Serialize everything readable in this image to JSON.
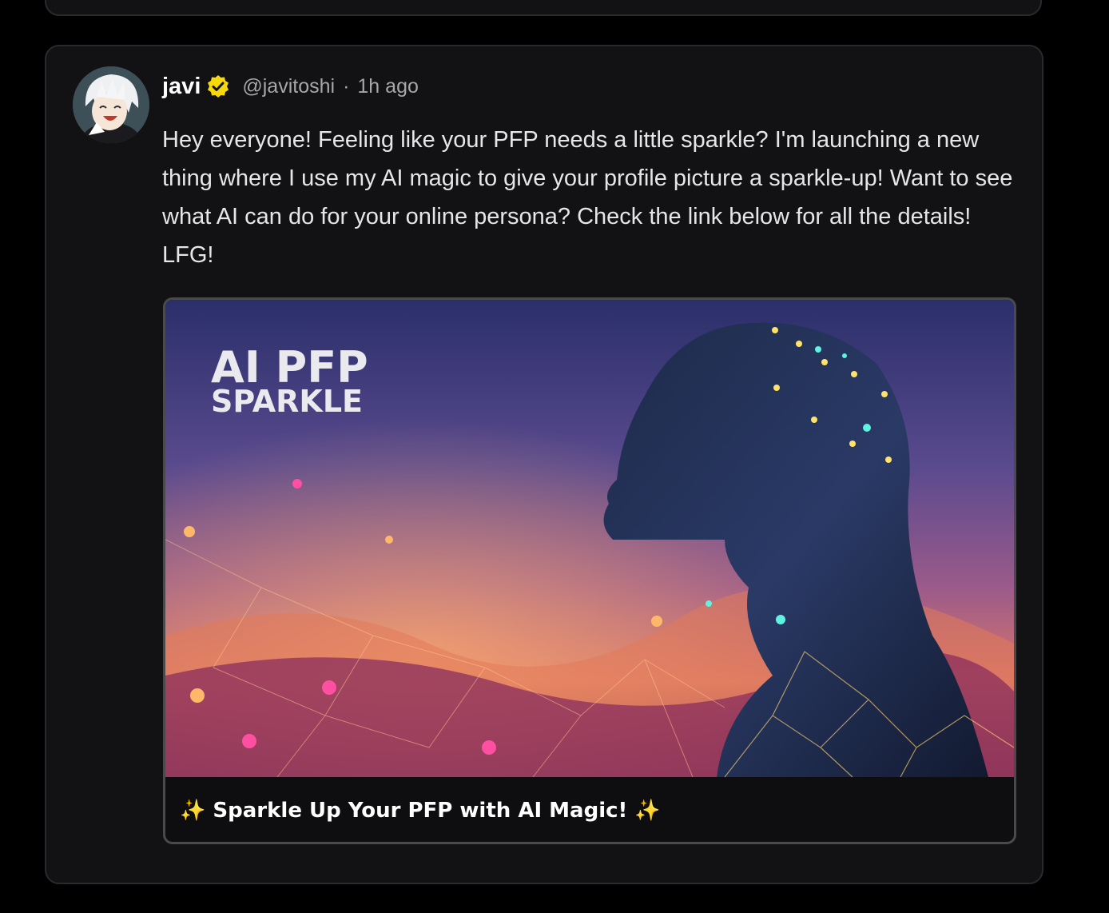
{
  "post": {
    "author": {
      "display_name": "javi",
      "verified_icon": "verified-badge-icon",
      "handle": "@javitoshi"
    },
    "separator": "·",
    "time": "1h ago",
    "text": "Hey everyone! Feeling like your PFP needs a little sparkle? I'm launching a new thing where I use my AI magic to give your profile picture a sparkle-up! Want to see what AI can do for your online persona? Check the link below for all the details! LFG!",
    "embed": {
      "image_text_line1": "AI PFP",
      "image_text_line2": "SPARKLE",
      "title": "✨ Sparkle Up Your PFP with AI Magic! ✨"
    }
  },
  "colors": {
    "background": "#000000",
    "card": "#121214",
    "card_border": "#2a2a2e",
    "verified": "#f5d90a",
    "muted_text": "#a6a6ab",
    "body_text": "#e6e6e6"
  }
}
